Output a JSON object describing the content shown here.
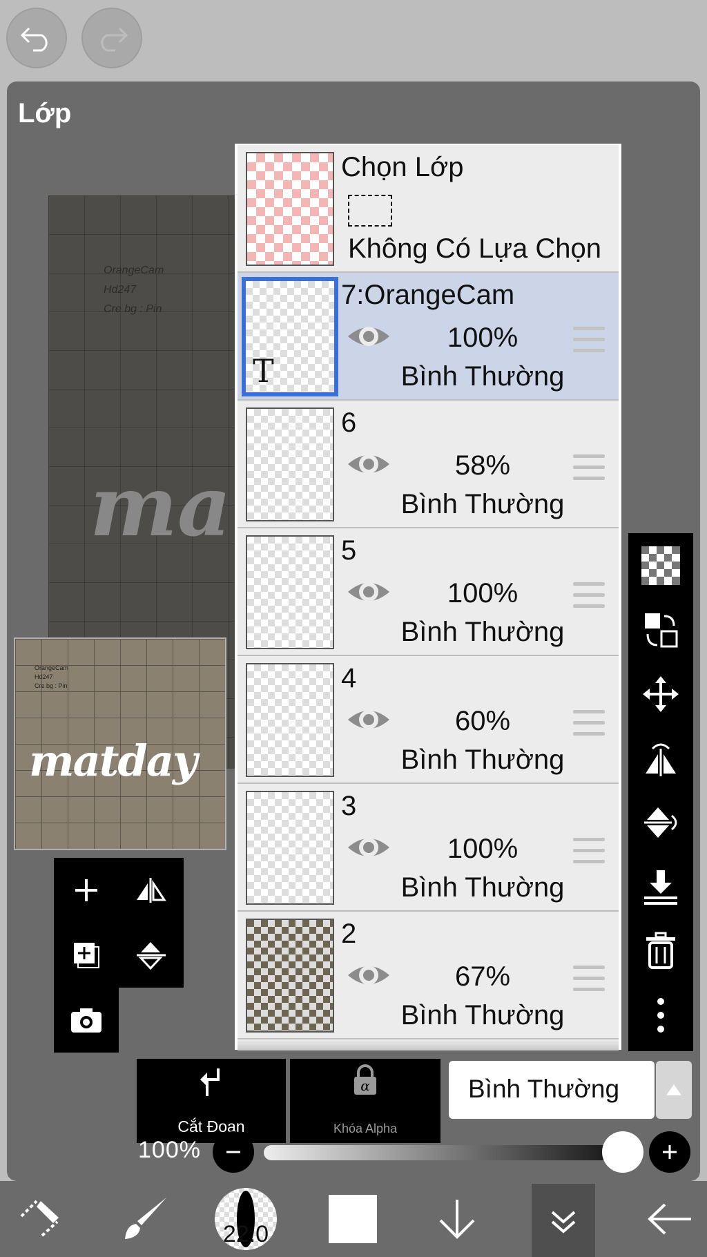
{
  "panel": {
    "title": "Lớp"
  },
  "canvas": {
    "lines": [
      "OrangeCam",
      "Hd247",
      "Cre bg : Pin"
    ],
    "word": "ma"
  },
  "thumbnail": {
    "lines": [
      "OrangeCam",
      "Hd247",
      "Cre bg : Pin"
    ],
    "word": "matday"
  },
  "selection_layer": {
    "title": "Chọn Lớp",
    "status": "Không Có Lựa Chọn"
  },
  "layers": [
    {
      "name": "7:OrangeCam",
      "opacity": "100%",
      "blend": "Bình Thường",
      "selected": true,
      "thumb_letter": "T"
    },
    {
      "name": "6",
      "opacity": "58%",
      "blend": "Bình Thường",
      "selected": false
    },
    {
      "name": "5",
      "opacity": "100%",
      "blend": "Bình Thường",
      "selected": false
    },
    {
      "name": "4",
      "opacity": "60%",
      "blend": "Bình Thường",
      "selected": false
    },
    {
      "name": "3",
      "opacity": "100%",
      "blend": "Bình Thường",
      "selected": false
    },
    {
      "name": "2",
      "opacity": "67%",
      "blend": "Bình Thường",
      "selected": false
    }
  ],
  "bottom_controls": {
    "clip_label": "Cắt Đoạn",
    "alpha_lock_label": "Khóa Alpha",
    "blend_mode": "Bình Thường",
    "opacity_value": "100%",
    "opacity_fraction": 1.0
  },
  "toolbar": {
    "brush_size": "22.0"
  },
  "colors": {
    "accent": "#3a6fd6",
    "selected_row": "#ccd5e8",
    "panel": "#6b6b6b"
  }
}
